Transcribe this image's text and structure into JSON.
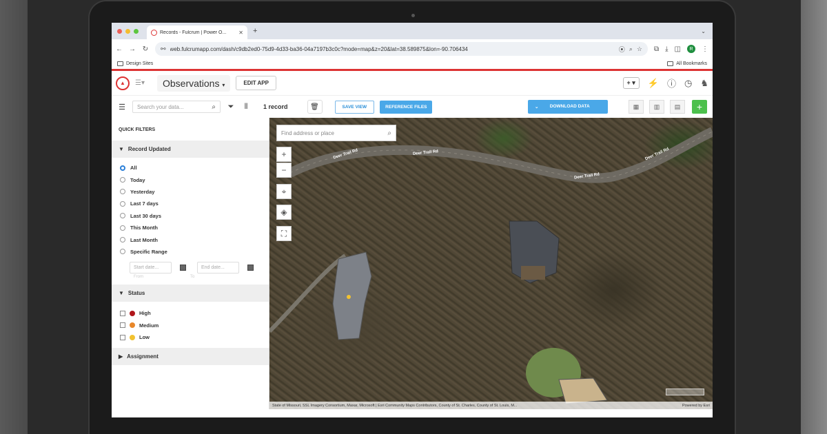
{
  "browser": {
    "tab_title": "Records - Fulcrum | Power O...",
    "url": "web.fulcrumapp.com/dash/c9db2ed0-75d9-4d33-ba36-04a7197b3c0c?mode=map&z=20&lat=38.589875&lon=-90.706434",
    "bookmark_left": "Design Sites",
    "bookmark_right": "All Bookmarks",
    "profile_initial": "R"
  },
  "app": {
    "title": "Observations",
    "edit_app_label": "EDIT APP",
    "add_label": "+"
  },
  "toolbar": {
    "search_placeholder": "Search your data...",
    "record_count": "1 record",
    "save_view_label": "SAVE VIEW",
    "reference_files_label": "REFERENCE FILES",
    "download_data_label": "DOWNLOAD DATA"
  },
  "sidebar": {
    "quick_filters_title": "QUICK FILTERS",
    "record_updated_title": "Record Updated",
    "record_updated_options": [
      "All",
      "Today",
      "Yesterday",
      "Last 7 days",
      "Last 30 days",
      "This Month",
      "Last Month",
      "Specific Range"
    ],
    "selected_option": "All",
    "start_date_placeholder": "Start date...",
    "end_date_placeholder": "End date...",
    "from_hint": "From",
    "to_hint": "To",
    "status_title": "Status",
    "status_options": [
      {
        "label": "High",
        "color": "#b0161b"
      },
      {
        "label": "Medium",
        "color": "#e8872a"
      },
      {
        "label": "Low",
        "color": "#f2c230"
      }
    ],
    "assignment_title": "Assignment"
  },
  "map": {
    "search_placeholder": "Find address or place",
    "road_name": "Deer Trail Rd",
    "attribution_left": "State of Missouri, SSL Imagery Consortium, Maxar, Microsoft | Esri Community Maps Contributors, County of St. Charles, County of St. Louis, M...",
    "attribution_right": "Powered by Esri"
  },
  "colors": {
    "brand_red": "#d33333",
    "accent_blue": "#4aa8e8",
    "add_green": "#4cc04c"
  }
}
